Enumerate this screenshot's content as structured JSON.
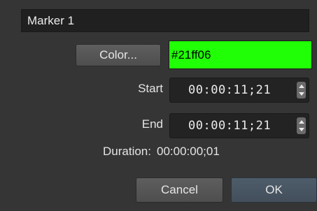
{
  "marker": {
    "name_value": "Marker 1"
  },
  "color": {
    "button_label": "Color...",
    "value": "#21ff06"
  },
  "start": {
    "label": "Start",
    "timecode": "00:00:11;21"
  },
  "end": {
    "label": "End",
    "timecode": "00:00:11;21"
  },
  "duration": {
    "label": "Duration:",
    "value": "00:00:00;01"
  },
  "buttons": {
    "cancel_label": "Cancel",
    "ok_label": "OK"
  },
  "icons": {
    "spinner": "stepper-arrows-icon"
  }
}
